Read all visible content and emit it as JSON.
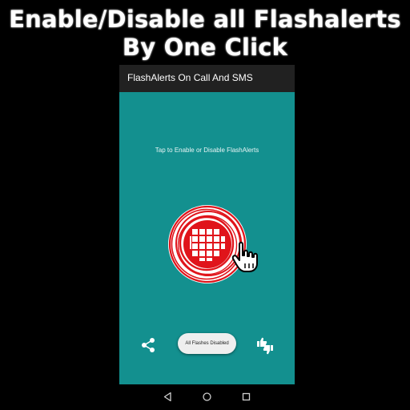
{
  "banner": {
    "line1": "Enable/Disable all Flashalerts",
    "line2": "By One Click"
  },
  "app": {
    "title": "FlashAlerts On Call And SMS",
    "hint": "Tap to Enable or Disable FlashAlerts",
    "status_button": "All Flashes Disabled"
  },
  "icons": {
    "toggle": "flash-toggle-icon",
    "pointer": "pointing-hand-icon",
    "share": "share-icon",
    "rate": "thumbs-up-down-icon",
    "back": "back-icon",
    "home": "home-icon",
    "recents": "recents-icon"
  },
  "colors": {
    "background": "#000000",
    "content": "#13908f",
    "appbar": "#212121",
    "toggle_red": "#e0141b"
  }
}
